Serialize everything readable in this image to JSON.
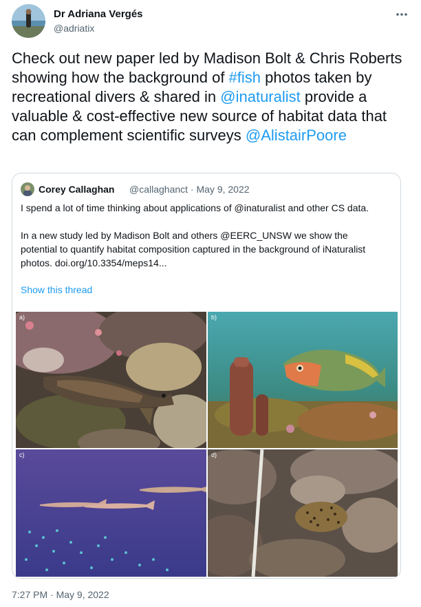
{
  "author": {
    "display_name": "Dr Adriana Vergés",
    "handle": "@adriatix"
  },
  "tweet": {
    "text_1": "Check out new paper led by Madison Bolt & Chris Roberts showing how the background of ",
    "hashtag": "#fish",
    "text_2": " photos taken by recreational divers & shared in ",
    "mention_1": "@inaturalist",
    "text_3": " provide a valuable & cost-effective new source of habitat data that can complement scientific surveys ",
    "mention_2": "@AlistairPoore"
  },
  "quoted": {
    "display_name": "Corey Callaghan",
    "meta": "@callaghanct · May 9, 2022",
    "para_1": "I spend a lot of time thinking about applications of @inaturalist and other CS data.",
    "para_2": "In a new study led by Madison Bolt and others @EERC_UNSW we show the potential to quantify habitat composition captured in the background of iNaturalist photos. doi.org/10.3354/meps14...",
    "show_thread": "Show this thread",
    "panels": [
      {
        "label": "a)",
        "subject": "goby on coral reef"
      },
      {
        "label": "b)",
        "subject": "parrotfish over sponge reef"
      },
      {
        "label": "c)",
        "subject": "barracuda in blue water"
      },
      {
        "label": "d)",
        "subject": "moray eel with transect tape"
      }
    ]
  },
  "timestamp": "7:27 PM · May 9, 2022",
  "colors": {
    "link": "#1d9bf0",
    "text": "#0f1419",
    "secondary": "#536471",
    "border": "#cfd9de"
  },
  "icons": {
    "more": "more-horizontal-icon"
  }
}
